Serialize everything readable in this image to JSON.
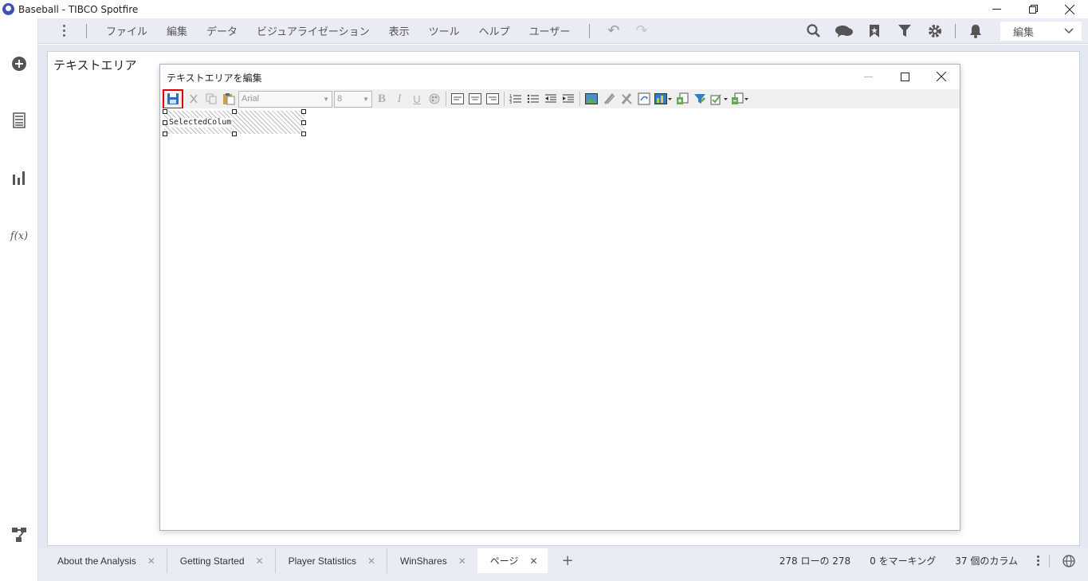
{
  "window": {
    "title": "Baseball - TIBCO Spotfire"
  },
  "menu": {
    "items": [
      "ファイル",
      "編集",
      "データ",
      "ビジュアライゼーション",
      "表示",
      "ツール",
      "ヘルプ",
      "ユーザー"
    ],
    "mode_select": "編集"
  },
  "panel": {
    "title": "テキストエリア"
  },
  "dialog": {
    "title": "テキストエリアを編集",
    "font_name": "Arial",
    "font_size": "8",
    "bold": "B",
    "italic": "I",
    "underline": "U",
    "control_text": "SelectedColum"
  },
  "tabs": [
    {
      "label": "About the Analysis"
    },
    {
      "label": "Getting Started"
    },
    {
      "label": "Player Statistics"
    },
    {
      "label": "WinShares"
    },
    {
      "label": "ページ"
    }
  ],
  "status": {
    "rows": "278 ローの 278",
    "marked": "0 をマーキング",
    "columns": "37 個のカラム"
  },
  "colors": {
    "accent": "#3f51b5",
    "highlight": "#e00000",
    "menubar": "#e9ecf4"
  }
}
